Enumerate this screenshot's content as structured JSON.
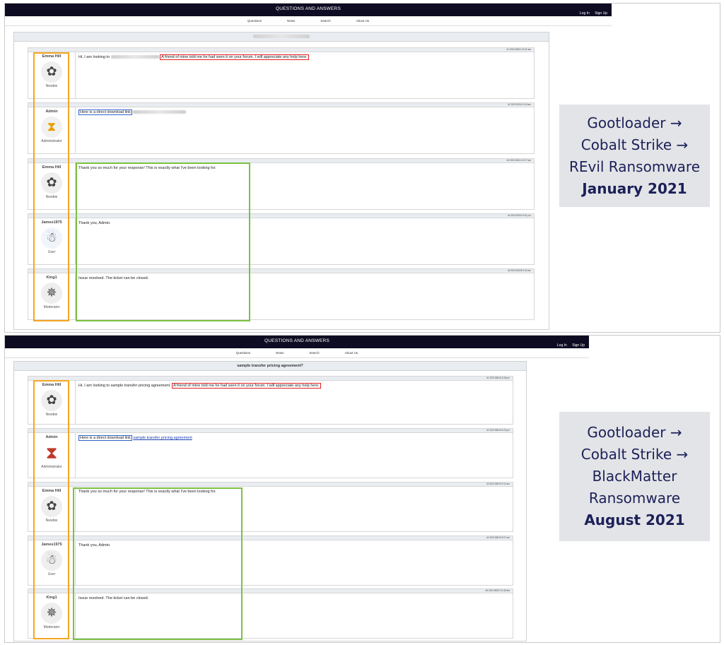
{
  "panels": [
    {
      "header_title": "QUESTIONS AND ANSWERS",
      "auth": [
        "Log In",
        "Sign Up"
      ],
      "nav": [
        "Questions",
        "News",
        "Search",
        "About Us"
      ],
      "thread_title": "",
      "posts": [
        {
          "user": "Emma Hill",
          "role": "Newbie",
          "avatar_icon": "flower-icon",
          "meta": "#1 2021/03/04 12:02 am",
          "pre": "Hi, I am looking to",
          "highlight": "A friend of mine told me he had seen it on your forum. I will appreciate any help here."
        },
        {
          "user": "Admin",
          "role": "Administrator",
          "avatar_icon": "hourglass-icon",
          "meta": "#2 2021/03/04 2:43 am",
          "boxed": "Here is a direct download link"
        },
        {
          "user": "Emma Hill",
          "role": "Newbie",
          "avatar_icon": "flower-icon",
          "meta": "#3 2021/03/04 12:27 pm",
          "text": "Thank you so much for your response! This is exactly what I've been looking for."
        },
        {
          "user": "James1975",
          "role": "User",
          "avatar_icon": "snowman-icon",
          "meta": "#4 2021/03/04 3:01 pm",
          "text": "Thank you, Admin."
        },
        {
          "user": "King1",
          "role": "Moderator",
          "avatar_icon": "star-icon",
          "meta": "#5 2021/03/05 3:40 am",
          "text": "Issue resolved. The ticket can be closed."
        }
      ],
      "info": {
        "lines": [
          "Gootloader →",
          "Cobalt Strike →",
          "REvil Ransomware"
        ],
        "date": "January 2021"
      }
    },
    {
      "header_title": "QUESTIONS AND ANSWERS",
      "auth": [
        "Log In",
        "Sign Up"
      ],
      "nav": [
        "Questions",
        "News",
        "Search",
        "About Us"
      ],
      "thread_title": "sample transfer pricing agreement?",
      "posts": [
        {
          "user": "Emma Hill",
          "role": "Newbie",
          "avatar_icon": "flower-icon",
          "meta": "#1 2021/08/18 4:28 pm",
          "pre": "Hi, I am looking to sample transfer pricing agreement.",
          "highlight": "A friend of mine told me he had seen it on your forum. I will appreciate any help here."
        },
        {
          "user": "Admin",
          "role": "Administrator",
          "avatar_icon": "hourglass-icon",
          "meta": "#2 2021/08/18 5:20 pm",
          "boxed": "Here is a direct download link",
          "link": "sample transfer pricing agreement"
        },
        {
          "user": "Emma Hill",
          "role": "Newbie",
          "avatar_icon": "flower-icon",
          "meta": "#3 2021/08/19 9:14 am",
          "text": "Thank you so much for your response! This is exactly what I've been looking for."
        },
        {
          "user": "James1975",
          "role": "User",
          "avatar_icon": "snowman-icon",
          "meta": "#4 2021/08/20 5:07 am",
          "text": "Thank you, Admin."
        },
        {
          "user": "King1",
          "role": "Moderator",
          "avatar_icon": "star-icon",
          "meta": "#5 2021/08/20 10:48 am",
          "text": "Issue resolved. The ticket can be closed."
        }
      ],
      "info": {
        "lines": [
          "Gootloader →",
          "Cobalt Strike →",
          "BlackMatter",
          "Ransomware"
        ],
        "date": "August 2021"
      }
    }
  ],
  "colors": {
    "header_bg": "#0d0c22",
    "orange_box": "#f5a623",
    "green_box": "#7cc143",
    "red_box": "#e01d1d",
    "info_text": "#1c2058",
    "info_bg": "#e3e4e7"
  }
}
